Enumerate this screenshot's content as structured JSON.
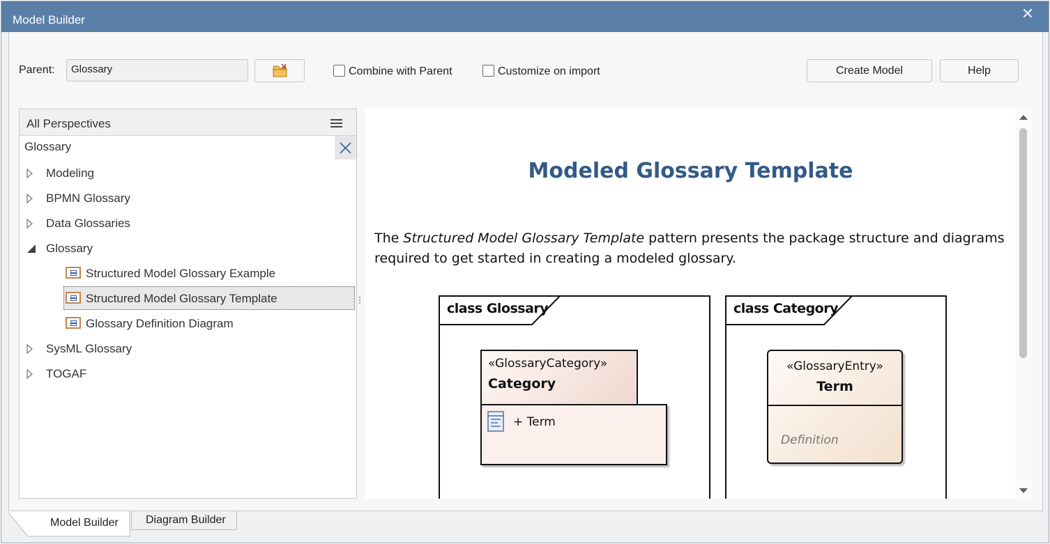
{
  "window": {
    "title": "Model Builder",
    "close_glyph": "✕"
  },
  "toolbar": {
    "parent_label": "Parent:",
    "parent_value": "Glossary",
    "combine_label": "Combine with Parent",
    "customize_label": "Customize on import",
    "create_label": "Create Model",
    "help_label": "Help"
  },
  "perspectives": {
    "header": "All Perspectives",
    "search_value": "Glossary",
    "tree": [
      {
        "label": "Modeling",
        "state": "collapsed"
      },
      {
        "label": "BPMN Glossary",
        "state": "collapsed"
      },
      {
        "label": "Data Glossaries",
        "state": "collapsed"
      },
      {
        "label": "Glossary",
        "state": "expanded"
      },
      {
        "label": "Structured Model Glossary Example",
        "state": "leaf"
      },
      {
        "label": "Structured Model Glossary Template",
        "state": "leaf",
        "selected": true
      },
      {
        "label": "Glossary Definition Diagram",
        "state": "leaf"
      },
      {
        "label": "SysML Glossary",
        "state": "collapsed"
      },
      {
        "label": "TOGAF",
        "state": "collapsed"
      }
    ]
  },
  "document": {
    "title": "Modeled Glossary Template",
    "para_before": "The ",
    "para_italic": "Structured Model Glossary Template",
    "para_after": " pattern presents the package structure and diagrams required to get started in creating a modeled glossary.",
    "diagram1": {
      "frame_label": "class Glossary",
      "stereotype": "«GlossaryCategory»",
      "name": "Category",
      "attribute": "+ Term"
    },
    "diagram2": {
      "frame_label": "class Category",
      "stereotype": "«GlossaryEntry»",
      "name": "Term",
      "attribute": "Definition"
    }
  },
  "tabs": [
    {
      "label": "Model Builder",
      "active": true
    },
    {
      "label": "Diagram Builder",
      "active": false
    }
  ],
  "colors": {
    "titlebar": "#5a7fa8",
    "doc_title": "#335a86",
    "diagram_icon_border": "#c7844f"
  },
  "icons": {
    "close": "close-icon",
    "browse": "folder-icon",
    "menu": "hamburger-menu-icon",
    "clear": "clear-search-icon",
    "diagram": "diagram-icon",
    "attribute": "attribute-icon"
  }
}
